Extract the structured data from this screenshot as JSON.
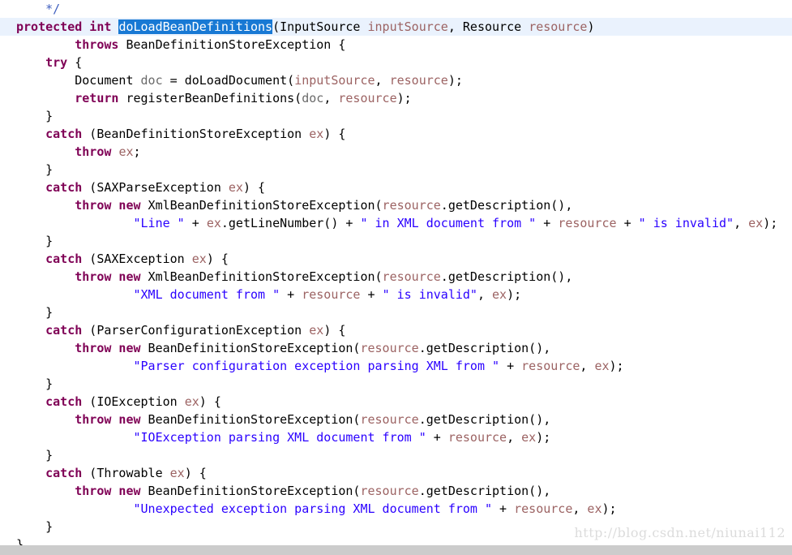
{
  "editor": {
    "name": "java-code-editor",
    "language": "Java",
    "colors": {
      "background": "#ffffff",
      "keyword": "#7f0055",
      "string": "#2a00ff",
      "comment": "#3f5fbf",
      "local_variable": "#6a6a6a",
      "parameter": "#9c6363",
      "plain_text": "#000000",
      "selection_background": "#1879d4",
      "selection_foreground": "#ffffff",
      "current_line_background": "#eaf2fd",
      "statusbar": "#cccccc",
      "watermark": "#dcdcdc"
    },
    "selection": {
      "text": "doLoadBeanDefinitions",
      "line": 2
    },
    "lines": [
      {
        "n": 1,
        "current": false,
        "tokens": [
          {
            "t": "    ",
            "c": "plain"
          },
          {
            "t": "*/",
            "c": "cmt"
          }
        ]
      },
      {
        "n": 2,
        "current": true,
        "tokens": [
          {
            "t": "protected int ",
            "c": "kw"
          },
          {
            "t": "doLoadBeanDefinitions",
            "c": "sel"
          },
          {
            "t": "(InputSource ",
            "c": "plain"
          },
          {
            "t": "inputSource",
            "c": "param"
          },
          {
            "t": ", Resource ",
            "c": "plain"
          },
          {
            "t": "resource",
            "c": "param"
          },
          {
            "t": ")",
            "c": "plain"
          }
        ]
      },
      {
        "n": 3,
        "current": false,
        "tokens": [
          {
            "t": "        ",
            "c": "plain"
          },
          {
            "t": "throws",
            "c": "kw"
          },
          {
            "t": " BeanDefinitionStoreException {",
            "c": "plain"
          }
        ]
      },
      {
        "n": 4,
        "current": false,
        "tokens": [
          {
            "t": "    ",
            "c": "plain"
          },
          {
            "t": "try",
            "c": "kw"
          },
          {
            "t": " {",
            "c": "plain"
          }
        ]
      },
      {
        "n": 5,
        "current": false,
        "tokens": [
          {
            "t": "        Document ",
            "c": "plain"
          },
          {
            "t": "doc",
            "c": "local"
          },
          {
            "t": " = doLoadDocument(",
            "c": "plain"
          },
          {
            "t": "inputSource",
            "c": "param"
          },
          {
            "t": ", ",
            "c": "plain"
          },
          {
            "t": "resource",
            "c": "param"
          },
          {
            "t": ");",
            "c": "plain"
          }
        ]
      },
      {
        "n": 6,
        "current": false,
        "tokens": [
          {
            "t": "        ",
            "c": "plain"
          },
          {
            "t": "return",
            "c": "kw"
          },
          {
            "t": " registerBeanDefinitions(",
            "c": "plain"
          },
          {
            "t": "doc",
            "c": "local"
          },
          {
            "t": ", ",
            "c": "plain"
          },
          {
            "t": "resource",
            "c": "param"
          },
          {
            "t": ");",
            "c": "plain"
          }
        ]
      },
      {
        "n": 7,
        "current": false,
        "tokens": [
          {
            "t": "    }",
            "c": "plain"
          }
        ]
      },
      {
        "n": 8,
        "current": false,
        "tokens": [
          {
            "t": "    ",
            "c": "plain"
          },
          {
            "t": "catch",
            "c": "kw"
          },
          {
            "t": " (BeanDefinitionStoreException ",
            "c": "plain"
          },
          {
            "t": "ex",
            "c": "param"
          },
          {
            "t": ") {",
            "c": "plain"
          }
        ]
      },
      {
        "n": 9,
        "current": false,
        "tokens": [
          {
            "t": "        ",
            "c": "plain"
          },
          {
            "t": "throw",
            "c": "kw"
          },
          {
            "t": " ",
            "c": "plain"
          },
          {
            "t": "ex",
            "c": "param"
          },
          {
            "t": ";",
            "c": "plain"
          }
        ]
      },
      {
        "n": 10,
        "current": false,
        "tokens": [
          {
            "t": "    }",
            "c": "plain"
          }
        ]
      },
      {
        "n": 11,
        "current": false,
        "tokens": [
          {
            "t": "    ",
            "c": "plain"
          },
          {
            "t": "catch",
            "c": "kw"
          },
          {
            "t": " (SAXParseException ",
            "c": "plain"
          },
          {
            "t": "ex",
            "c": "param"
          },
          {
            "t": ") {",
            "c": "plain"
          }
        ]
      },
      {
        "n": 12,
        "current": false,
        "tokens": [
          {
            "t": "        ",
            "c": "plain"
          },
          {
            "t": "throw new",
            "c": "kw"
          },
          {
            "t": " XmlBeanDefinitionStoreException(",
            "c": "plain"
          },
          {
            "t": "resource",
            "c": "param"
          },
          {
            "t": ".getDescription(),",
            "c": "plain"
          }
        ]
      },
      {
        "n": 13,
        "current": false,
        "tokens": [
          {
            "t": "                ",
            "c": "plain"
          },
          {
            "t": "\"Line \"",
            "c": "str"
          },
          {
            "t": " + ",
            "c": "plain"
          },
          {
            "t": "ex",
            "c": "param"
          },
          {
            "t": ".getLineNumber() + ",
            "c": "plain"
          },
          {
            "t": "\" in XML document from \"",
            "c": "str"
          },
          {
            "t": " + ",
            "c": "plain"
          },
          {
            "t": "resource",
            "c": "param"
          },
          {
            "t": " + ",
            "c": "plain"
          },
          {
            "t": "\" is invalid\"",
            "c": "str"
          },
          {
            "t": ", ",
            "c": "plain"
          },
          {
            "t": "ex",
            "c": "param"
          },
          {
            "t": ");",
            "c": "plain"
          }
        ]
      },
      {
        "n": 14,
        "current": false,
        "tokens": [
          {
            "t": "    }",
            "c": "plain"
          }
        ]
      },
      {
        "n": 15,
        "current": false,
        "tokens": [
          {
            "t": "    ",
            "c": "plain"
          },
          {
            "t": "catch",
            "c": "kw"
          },
          {
            "t": " (SAXException ",
            "c": "plain"
          },
          {
            "t": "ex",
            "c": "param"
          },
          {
            "t": ") {",
            "c": "plain"
          }
        ]
      },
      {
        "n": 16,
        "current": false,
        "tokens": [
          {
            "t": "        ",
            "c": "plain"
          },
          {
            "t": "throw new",
            "c": "kw"
          },
          {
            "t": " XmlBeanDefinitionStoreException(",
            "c": "plain"
          },
          {
            "t": "resource",
            "c": "param"
          },
          {
            "t": ".getDescription(),",
            "c": "plain"
          }
        ]
      },
      {
        "n": 17,
        "current": false,
        "tokens": [
          {
            "t": "                ",
            "c": "plain"
          },
          {
            "t": "\"XML document from \"",
            "c": "str"
          },
          {
            "t": " + ",
            "c": "plain"
          },
          {
            "t": "resource",
            "c": "param"
          },
          {
            "t": " + ",
            "c": "plain"
          },
          {
            "t": "\" is invalid\"",
            "c": "str"
          },
          {
            "t": ", ",
            "c": "plain"
          },
          {
            "t": "ex",
            "c": "param"
          },
          {
            "t": ");",
            "c": "plain"
          }
        ]
      },
      {
        "n": 18,
        "current": false,
        "tokens": [
          {
            "t": "    }",
            "c": "plain"
          }
        ]
      },
      {
        "n": 19,
        "current": false,
        "tokens": [
          {
            "t": "    ",
            "c": "plain"
          },
          {
            "t": "catch",
            "c": "kw"
          },
          {
            "t": " (ParserConfigurationException ",
            "c": "plain"
          },
          {
            "t": "ex",
            "c": "param"
          },
          {
            "t": ") {",
            "c": "plain"
          }
        ]
      },
      {
        "n": 20,
        "current": false,
        "tokens": [
          {
            "t": "        ",
            "c": "plain"
          },
          {
            "t": "throw new",
            "c": "kw"
          },
          {
            "t": " BeanDefinitionStoreException(",
            "c": "plain"
          },
          {
            "t": "resource",
            "c": "param"
          },
          {
            "t": ".getDescription(),",
            "c": "plain"
          }
        ]
      },
      {
        "n": 21,
        "current": false,
        "tokens": [
          {
            "t": "                ",
            "c": "plain"
          },
          {
            "t": "\"Parser configuration exception parsing XML from \"",
            "c": "str"
          },
          {
            "t": " + ",
            "c": "plain"
          },
          {
            "t": "resource",
            "c": "param"
          },
          {
            "t": ", ",
            "c": "plain"
          },
          {
            "t": "ex",
            "c": "param"
          },
          {
            "t": ");",
            "c": "plain"
          }
        ]
      },
      {
        "n": 22,
        "current": false,
        "tokens": [
          {
            "t": "    }",
            "c": "plain"
          }
        ]
      },
      {
        "n": 23,
        "current": false,
        "tokens": [
          {
            "t": "    ",
            "c": "plain"
          },
          {
            "t": "catch",
            "c": "kw"
          },
          {
            "t": " (IOException ",
            "c": "plain"
          },
          {
            "t": "ex",
            "c": "param"
          },
          {
            "t": ") {",
            "c": "plain"
          }
        ]
      },
      {
        "n": 24,
        "current": false,
        "tokens": [
          {
            "t": "        ",
            "c": "plain"
          },
          {
            "t": "throw new",
            "c": "kw"
          },
          {
            "t": " BeanDefinitionStoreException(",
            "c": "plain"
          },
          {
            "t": "resource",
            "c": "param"
          },
          {
            "t": ".getDescription(),",
            "c": "plain"
          }
        ]
      },
      {
        "n": 25,
        "current": false,
        "tokens": [
          {
            "t": "                ",
            "c": "plain"
          },
          {
            "t": "\"IOException parsing XML document from \"",
            "c": "str"
          },
          {
            "t": " + ",
            "c": "plain"
          },
          {
            "t": "resource",
            "c": "param"
          },
          {
            "t": ", ",
            "c": "plain"
          },
          {
            "t": "ex",
            "c": "param"
          },
          {
            "t": ");",
            "c": "plain"
          }
        ]
      },
      {
        "n": 26,
        "current": false,
        "tokens": [
          {
            "t": "    }",
            "c": "plain"
          }
        ]
      },
      {
        "n": 27,
        "current": false,
        "tokens": [
          {
            "t": "    ",
            "c": "plain"
          },
          {
            "t": "catch",
            "c": "kw"
          },
          {
            "t": " (Throwable ",
            "c": "plain"
          },
          {
            "t": "ex",
            "c": "param"
          },
          {
            "t": ") {",
            "c": "plain"
          }
        ]
      },
      {
        "n": 28,
        "current": false,
        "tokens": [
          {
            "t": "        ",
            "c": "plain"
          },
          {
            "t": "throw new",
            "c": "kw"
          },
          {
            "t": " BeanDefinitionStoreException(",
            "c": "plain"
          },
          {
            "t": "resource",
            "c": "param"
          },
          {
            "t": ".getDescription(),",
            "c": "plain"
          }
        ]
      },
      {
        "n": 29,
        "current": false,
        "tokens": [
          {
            "t": "                ",
            "c": "plain"
          },
          {
            "t": "\"Unexpected exception parsing XML document from \"",
            "c": "str"
          },
          {
            "t": " + ",
            "c": "plain"
          },
          {
            "t": "resource",
            "c": "param"
          },
          {
            "t": ", ",
            "c": "plain"
          },
          {
            "t": "ex",
            "c": "param"
          },
          {
            "t": ");",
            "c": "plain"
          }
        ]
      },
      {
        "n": 30,
        "current": false,
        "tokens": [
          {
            "t": "    }",
            "c": "plain"
          }
        ]
      },
      {
        "n": 31,
        "current": false,
        "tokens": [
          {
            "t": "}",
            "c": "plain"
          }
        ]
      }
    ]
  },
  "watermark": {
    "text": "http://blog.csdn.net/niunai112"
  }
}
